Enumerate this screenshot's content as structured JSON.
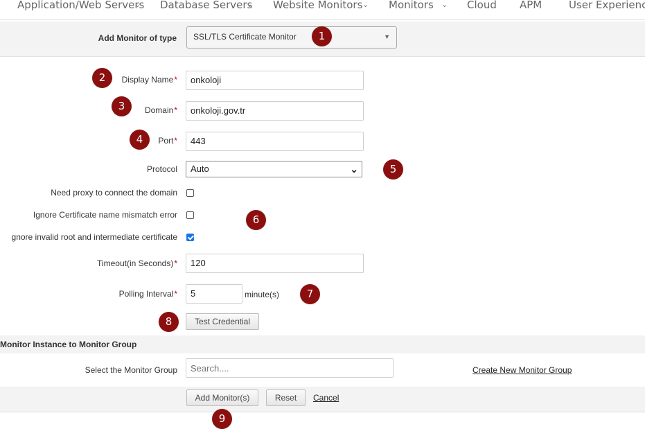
{
  "nav": {
    "items": [
      "Application/Web Servers",
      "Database Servers",
      "Website Monitors",
      "Monitors",
      "Cloud",
      "APM",
      "User Experience"
    ]
  },
  "monitor_type": {
    "label": "Add Monitor of type",
    "value": "SSL/TLS Certificate Monitor"
  },
  "form": {
    "display_name_label": "Display Name",
    "display_name_value": "onkoloji",
    "domain_label": "Domain",
    "domain_value": "onkoloji.gov.tr",
    "port_label": "Port",
    "port_value": "443",
    "protocol_label": "Protocol",
    "protocol_value": "Auto",
    "proxy_label": "Need proxy to connect the domain",
    "proxy_checked": false,
    "ignore_mismatch_label": "Ignore Certificate name mismatch error",
    "ignore_mismatch_checked": false,
    "ignore_invalid_label": "gnore invalid root and intermediate certificate",
    "ignore_invalid_checked": true,
    "timeout_label": "Timeout(in Seconds)",
    "timeout_value": "120",
    "polling_label": "Polling Interval",
    "polling_value": "5",
    "polling_unit": "minute(s)",
    "required_mark": "*",
    "test_credential_label": "Test Credential"
  },
  "group": {
    "section_title": "Monitor Instance to Monitor Group",
    "select_label": "Select the Monitor Group",
    "search_placeholder": "Search....",
    "create_link": "Create New Monitor Group"
  },
  "actions": {
    "add_label": "Add Monitor(s)",
    "reset_label": "Reset",
    "cancel_label": "Cancel"
  },
  "badges": [
    "1",
    "2",
    "3",
    "4",
    "5",
    "6",
    "7",
    "8",
    "9"
  ],
  "colors": {
    "badge": "#8b0f0f",
    "checkbox_checked": "#1a73e8",
    "band": "#f3f3f3",
    "required": "#cc0000"
  }
}
